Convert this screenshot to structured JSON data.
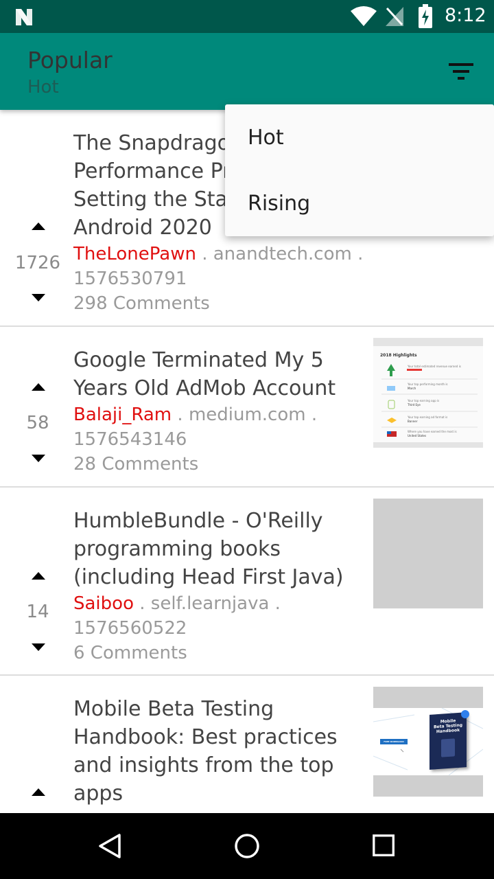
{
  "status_bar": {
    "time": "8:12"
  },
  "app_bar": {
    "title": "Popular",
    "subtitle": "Hot"
  },
  "sort_menu": {
    "items": [
      "Hot",
      "Rising"
    ]
  },
  "posts": [
    {
      "score": "1726",
      "title_lines": [
        "The Snapdragon",
        "Performance Pr",
        "Setting the Stag",
        "Android 2020"
      ],
      "author": "TheLonePawn",
      "domain": "anandtech.com",
      "timestamp": "1576530791",
      "comments": "298 Comments",
      "has_thumbnail": false
    },
    {
      "score": "58",
      "title_lines": [
        "Google Terminated My 5",
        "Years Old AdMob Account"
      ],
      "author": "Balaji_Ram",
      "domain": "medium.com",
      "timestamp": "1576543146",
      "comments": "28 Comments",
      "has_thumbnail": true,
      "thumbnail": {
        "heading": "2018 Highlights",
        "rows": [
          "Your total estimated revenue earned is",
          "Your top performing month is",
          "Your top earning app is",
          "Your top earning ad format is",
          "Where you have earned the most is"
        ],
        "values": [
          "March",
          "Third Eye",
          "Banner",
          "United States"
        ]
      }
    },
    {
      "score": "14",
      "title_lines": [
        "HumbleBundle - O'Reilly",
        "programming books",
        "(including Head First Java)"
      ],
      "author": "Saiboo",
      "domain": "self.learnjava",
      "timestamp": "1576560522",
      "comments": "6 Comments",
      "has_thumbnail": true
    },
    {
      "score": "",
      "title_lines": [
        "Mobile Beta Testing",
        "Handbook: Best practices",
        "and insights from the top",
        "apps"
      ],
      "has_thumbnail": true,
      "thumbnail": {
        "button": "FREE DOWNLOAD",
        "book_title_lines": [
          "Mobile",
          "Beta Testing",
          "Handbook"
        ]
      }
    }
  ],
  "separator": " . ",
  "colors": {
    "status_bar": "#00574b",
    "app_bar": "#00897b",
    "author": "#e01010",
    "meta": "#9a9a9a",
    "nav_bar": "#000000"
  },
  "icons": [
    "n-logo-icon",
    "wifi-icon",
    "no-signal-icon",
    "battery-charging-icon",
    "filter-icon",
    "upvote-icon",
    "downvote-icon",
    "back-icon",
    "home-icon",
    "recents-icon"
  ]
}
